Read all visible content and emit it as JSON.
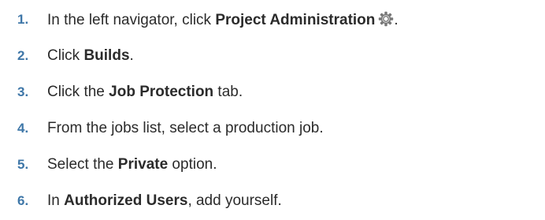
{
  "steps": [
    {
      "number": "1.",
      "pre": "In the left navigator, click ",
      "bold": "Project Administration",
      "post": ".",
      "icon": "gear-icon"
    },
    {
      "number": "2.",
      "pre": "Click ",
      "bold": "Builds",
      "post": "."
    },
    {
      "number": "3.",
      "pre": "Click the ",
      "bold": "Job Protection",
      "post": " tab."
    },
    {
      "number": "4.",
      "text": "From the jobs list, select a production job."
    },
    {
      "number": "5.",
      "pre": "Select the ",
      "bold": "Private",
      "post": " option."
    },
    {
      "number": "6.",
      "pre": "In ",
      "bold": "Authorized Users",
      "post": ", add yourself."
    }
  ],
  "colors": {
    "step_number": "#3f77a8",
    "text": "#2b2b2b"
  }
}
